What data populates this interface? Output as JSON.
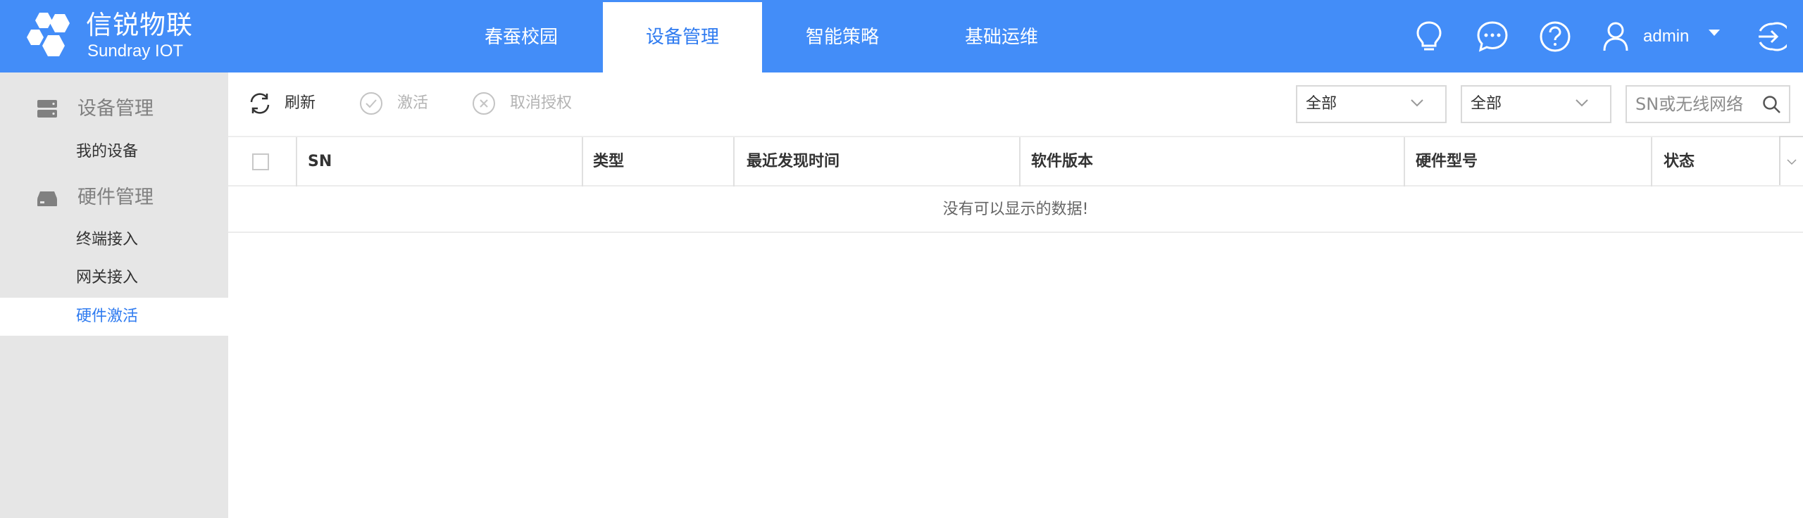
{
  "header": {
    "brand_name": "信锐物联",
    "brand_sub": "Sundray IOT",
    "tabs": [
      {
        "label": "春蚕校园",
        "active": false
      },
      {
        "label": "设备管理",
        "active": true
      },
      {
        "label": "智能策略",
        "active": false
      },
      {
        "label": "基础运维",
        "active": false
      }
    ],
    "icons": [
      "lightbulb-icon",
      "chat-icon",
      "help-icon",
      "user-icon",
      "logout-icon"
    ],
    "user": "admin"
  },
  "sidebar": {
    "groups": [
      {
        "label": "设备管理",
        "icon": "server-icon",
        "items": [
          {
            "label": "我的设备",
            "active": false
          }
        ]
      },
      {
        "label": "硬件管理",
        "icon": "hardware-icon",
        "items": [
          {
            "label": "终端接入",
            "active": false
          },
          {
            "label": "网关接入",
            "active": false
          },
          {
            "label": "硬件激活",
            "active": true
          }
        ]
      }
    ]
  },
  "toolbar": {
    "refresh": "刷新",
    "activate": "激活",
    "revoke": "取消授权",
    "filter1": "全部",
    "filter2": "全部",
    "search_placeholder": "SN或无线网络"
  },
  "table": {
    "columns": [
      "SN",
      "类型",
      "最近发现时间",
      "软件版本",
      "硬件型号",
      "状态"
    ],
    "empty_text": "没有可以显示的数据!"
  },
  "colors": {
    "primary": "#438df8",
    "active_text": "#2f7bf0",
    "sidebar_bg": "#e6e6e6"
  }
}
